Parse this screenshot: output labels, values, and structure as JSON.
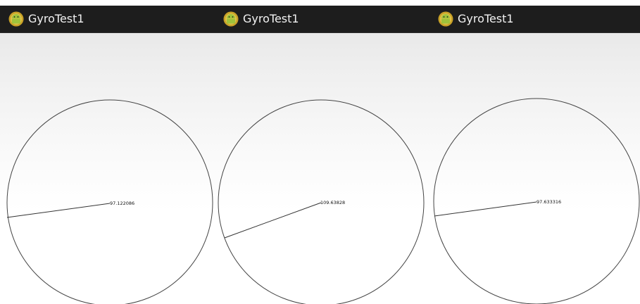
{
  "panels": [
    {
      "title": "GyroTest1",
      "reading": "97.122086",
      "app_icon": "android-app-icon"
    },
    {
      "title": "GyroTest1",
      "reading": "109.63828",
      "app_icon": "android-app-icon"
    },
    {
      "title": "GyroTest1",
      "reading": "97.633316",
      "app_icon": "android-app-icon"
    }
  ],
  "colors": {
    "action_bar": "#1d1d1d",
    "title_text": "#f2f2f2",
    "icon_green": "#9fc33b",
    "icon_gold": "#c9a227",
    "dial_stroke": "#444444"
  }
}
